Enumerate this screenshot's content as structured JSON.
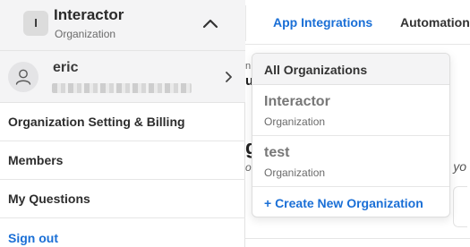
{
  "org": {
    "avatar_letter": "I",
    "name": "Interactor",
    "type": "Organization"
  },
  "user": {
    "name": "eric"
  },
  "menu": {
    "items": [
      {
        "label": "Organization Setting & Billing"
      },
      {
        "label": "Members"
      },
      {
        "label": "My Questions"
      },
      {
        "label": "Sign out"
      }
    ]
  },
  "topnav": {
    "tabs": [
      {
        "label": "App Integrations",
        "active": true
      },
      {
        "label": "Automation",
        "active": false
      }
    ]
  },
  "background_fragments": {
    "a": "n",
    "b": "u",
    "c": "g",
    "d": "oa",
    "e": "r yo"
  },
  "dropdown": {
    "header": "All Organizations",
    "orgs": [
      {
        "name": "Interactor",
        "type": "Organization"
      },
      {
        "name": "test",
        "type": "Organization"
      }
    ],
    "create_label": "+ Create New Organization"
  },
  "colors": {
    "accent": "#1a6fd6",
    "panel_bg": "#f4f4f5"
  },
  "icons": {
    "org_toggle": "chevron-up-icon",
    "user_expand": "chevron-right-icon",
    "user_avatar": "user-icon"
  }
}
